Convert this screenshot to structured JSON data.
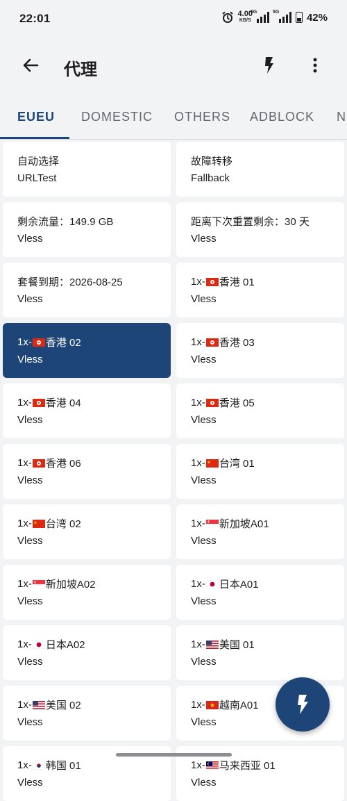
{
  "status": {
    "time": "22:01",
    "net_speed": "4.00",
    "net_unit": "KB/S",
    "sim1": "5G",
    "sim2": "5G",
    "battery": "42%"
  },
  "appbar": {
    "title": "代理",
    "icons": [
      "back-arrow-icon",
      "bolt-icon",
      "more-vert-icon"
    ]
  },
  "tabs": [
    {
      "label": "EUEU",
      "active": true
    },
    {
      "label": "DOMESTIC"
    },
    {
      "label": "OTHERS"
    },
    {
      "label": "ADBLOCK"
    },
    {
      "label": "N"
    }
  ],
  "proxies": [
    {
      "prefix": "自动选择",
      "flag": "",
      "suffix": "",
      "type": "URLTest"
    },
    {
      "prefix": "故障转移",
      "flag": "",
      "suffix": "",
      "type": "Fallback"
    },
    {
      "prefix": "剩余流量：149.9 GB",
      "flag": "",
      "suffix": "",
      "type": "Vless"
    },
    {
      "prefix": "距离下次重置剩余：30 天",
      "flag": "",
      "suffix": "",
      "type": "Vless"
    },
    {
      "prefix": "套餐到期：2026-08-25",
      "flag": "",
      "suffix": "",
      "type": "Vless"
    },
    {
      "prefix": "1x-",
      "flag": "hk",
      "suffix": "香港 01",
      "type": "Vless"
    },
    {
      "prefix": "1x-",
      "flag": "hk",
      "suffix": "香港 02",
      "type": "Vless",
      "selected": true
    },
    {
      "prefix": "1x-",
      "flag": "hk",
      "suffix": "香港 03",
      "type": "Vless"
    },
    {
      "prefix": "1x-",
      "flag": "hk",
      "suffix": "香港 04",
      "type": "Vless"
    },
    {
      "prefix": "1x-",
      "flag": "hk",
      "suffix": "香港 05",
      "type": "Vless"
    },
    {
      "prefix": "1x-",
      "flag": "hk",
      "suffix": "香港 06",
      "type": "Vless"
    },
    {
      "prefix": "1x-",
      "flag": "cn",
      "suffix": "台湾 01",
      "type": "Vless"
    },
    {
      "prefix": "1x-",
      "flag": "cn",
      "suffix": "台湾 02",
      "type": "Vless"
    },
    {
      "prefix": "1x-",
      "flag": "sg",
      "suffix": "新加坡A01",
      "type": "Vless"
    },
    {
      "prefix": "1x-",
      "flag": "sg",
      "suffix": "新加坡A02",
      "type": "Vless"
    },
    {
      "prefix": "1x-",
      "flag": "jp",
      "suffix": "日本A01",
      "type": "Vless"
    },
    {
      "prefix": "1x-",
      "flag": "jp",
      "suffix": "日本A02",
      "type": "Vless"
    },
    {
      "prefix": "1x-",
      "flag": "us",
      "suffix": "美国 01",
      "type": "Vless"
    },
    {
      "prefix": "1x-",
      "flag": "us",
      "suffix": "美国 02",
      "type": "Vless"
    },
    {
      "prefix": "1x-",
      "flag": "vn",
      "suffix": "越南A01",
      "type": "Vless"
    },
    {
      "prefix": "1x-",
      "flag": "kr",
      "suffix": "韩国 01",
      "type": "Vless"
    },
    {
      "prefix": "1x-",
      "flag": "my",
      "suffix": "马来西亚 01",
      "type": "Vless"
    }
  ],
  "fab": {
    "icon": "bolt-icon"
  },
  "colors": {
    "primary": "#1e4578",
    "background": "#f2f3f5",
    "card": "#ffffff"
  }
}
